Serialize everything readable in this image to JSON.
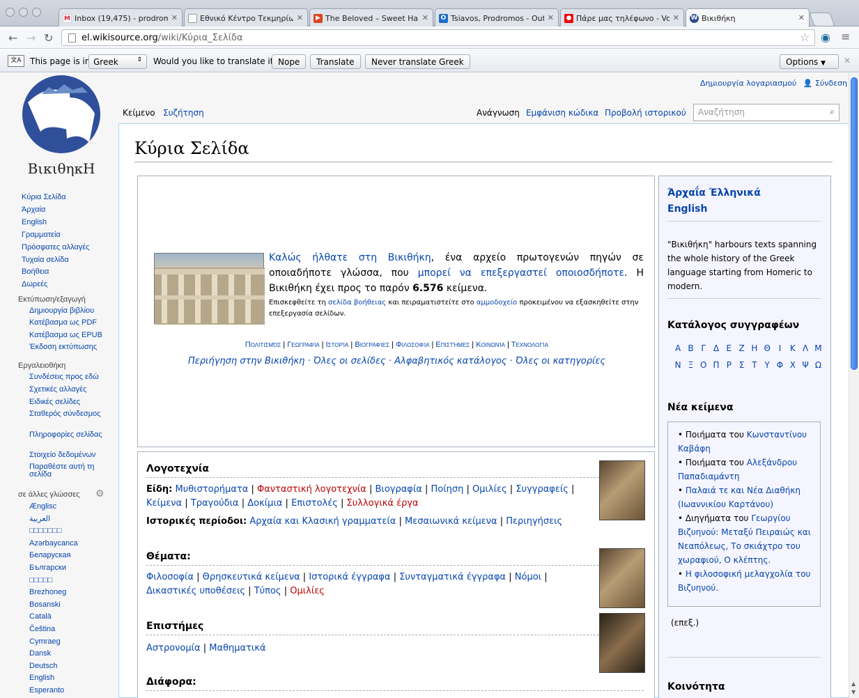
{
  "browser": {
    "tabs": [
      {
        "title": "Inbox (19,475) - prodromo",
        "icon": "gmail-icon"
      },
      {
        "title": "Εθνικό Κέντρο Τεκμηρίωση",
        "icon": "page-icon"
      },
      {
        "title": "The Beloved – Sweet Ha",
        "icon": "youtube-icon"
      },
      {
        "title": "Tsiavos, Prodromos - Outl",
        "icon": "outlook-icon"
      },
      {
        "title": "Πάρε μας τηλέφωνο - Vod",
        "icon": "vodafone-icon"
      },
      {
        "title": "Βικιθήκη",
        "icon": "wikisource-icon"
      }
    ],
    "url_host": "el.wikisource.org",
    "url_path": "/wiki/Κύρια_Σελίδα",
    "translate": {
      "prefix": "This page is in",
      "language": "Greek",
      "question": "Would you like to translate it?",
      "nope": "Nope",
      "translate": "Translate",
      "never": "Never translate Greek",
      "options": "Options"
    }
  },
  "logo": {
    "wordmark": "ΒικιθηκΗ"
  },
  "sidebar": {
    "nav": [
      "Κύρια Σελίδα",
      "Άρχαία",
      "English",
      "Γραμματεία",
      "Πρόσφατες αλλαγές",
      "Τυχαία σελίδα",
      "Βοήθεια",
      "Δωρεές"
    ],
    "print_head": "Εκτύπωση/εξαγωγή",
    "print": [
      "Δημιουργία βιβλίου",
      "Κατέβασμα ως PDF",
      "Κατέβασμα ως EPUB",
      "Έκδοση εκτύπωσης"
    ],
    "tools_head": "Εργαλειοθήκη",
    "tools": [
      "Συνδέσεις προς εδώ",
      "Σχετικές αλλαγές",
      "Ειδικές σελίδες",
      "Σταθερός σύνδεσμος",
      "Πληροφορίες σελίδας",
      "Στοιχείο δεδομένων",
      "Παραθέστε αυτή τη σελίδα"
    ],
    "lang_head": "σε άλλες γλώσσες",
    "langs": [
      "Ænglisc",
      "العربية",
      "□□□□□□□",
      "Azərbaycanca",
      "Беларуская",
      "Български",
      "□□□□□",
      "Brezhoneg",
      "Bosanski",
      "Català",
      "Čeština",
      "Cymraeg",
      "Dansk",
      "Deutsch",
      "English",
      "Esperanto"
    ]
  },
  "personal": {
    "create": "Δημιουργία λογαριασμού",
    "login": "Σύνδεση"
  },
  "tabs": {
    "page": "Κείμενο",
    "talk": "Συζήτηση",
    "read": "Ανάγνωση",
    "source": "Εμφάνιση κώδικα",
    "history": "Προβολή ιστορικού"
  },
  "search": {
    "placeholder": "Αναζήτηση"
  },
  "page_title": "Κύρια Σελίδα",
  "welcome": {
    "w1": "Καλώς ήλθατε στη Βικιθήκη",
    "w2": ", ένα αρχείο πρωτογενών πηγών σε οποιαδήποτε γλώσσα, που ",
    "w3": "μπορεί να επεξεργαστεί οποιοσδήποτε",
    "w4": ". Η Βικιθήκη έχει προς το παρόν ",
    "count": "6.576",
    "w5": " κείμενα.",
    "s1": "Επισκεφθείτε τη ",
    "s2": "σελίδα βοήθειας",
    "s3": " και πειραματιστείτε στο ",
    "s4": "αμμοδοχείο",
    "s5": " προκειμένου να εξασκηθείτε στην επεξεργασία σελίδων.",
    "cats": [
      "Πολιτισμός",
      "Γεωγραφία",
      "Ιστορία",
      "Βιογραφίες",
      "Φιλοσοφία",
      "Επιστήμες",
      "Κοινωνία",
      "Τεχνολογία"
    ],
    "nav": [
      "Περιήγηση στην Βικιθήκη",
      "Όλες οι σελίδες",
      "Αλφαβητικός κατάλογος",
      "Όλες οι κατηγορίες"
    ]
  },
  "literature": {
    "title": "Λογοτεχνία",
    "genres_label": "Είδη:",
    "genres": [
      "Μυθιστορήματα",
      "Φανταστική λογοτεχνία",
      "Βιογραφία",
      "Ποίηση",
      "Ομιλίες",
      "Συγγραφείς",
      "Κείμενα",
      "Τραγούδια",
      "Δοκίμια",
      "Επιστολές",
      "Συλλογικά έργα"
    ],
    "periods_label": "Ιστορικές περίοδοι:",
    "periods": [
      "Αρχαία και Κλασική γραμματεία",
      "Μεσαιωνικά κείμενα",
      "Περιηγήσεις"
    ],
    "themes_title": "Θέματα:",
    "themes": [
      "Φιλοσοφία",
      "Θρησκευτικά κείμενα",
      "Ιστορικά έγγραφα",
      "Συνταγματικά έγγραφα",
      "Νόμοι",
      "Δικαστικές υποθέσεις",
      "Τύπος",
      "Ομιλίες"
    ],
    "science_title": "Επιστήμες",
    "science": [
      "Αστρονομία",
      "Μαθηματικά"
    ],
    "misc_title": "Διάφορα:"
  },
  "right": {
    "ancient": "Άρχαΐα Έλληνικά",
    "english": "English",
    "blurb": "\"Βικιθήκη\" harbours texts spanning the whole history of the Greek language starting from Homeric to modern.",
    "authors_title": "Κατάλογος συγγραφέων",
    "letters1": [
      "Α",
      "Β",
      "Γ",
      "Δ",
      "Ε",
      "Ζ",
      "Η",
      "Θ",
      "Ι",
      "Κ",
      "Λ",
      "Μ"
    ],
    "letters2": [
      "Ν",
      "Ξ",
      "Ο",
      "Π",
      "Ρ",
      "Σ",
      "Τ",
      "Υ",
      "Φ",
      "Χ",
      "Ψ",
      "Ω"
    ],
    "new_title": "Νέα κείμενα",
    "n1a": "Ποιήματα του ",
    "n1b": "Κωνσταντίνου Καβάφη",
    "n2a": "Ποιήματα του ",
    "n2b": "Αλεξάνδρου Παπαδιαμάντη",
    "n3": "Παλαιά τε και Νέα Διαθήκη (Ιωαννικίου Καρτάνου)",
    "n4a": "Διηγήματα του ",
    "n4b": "Γεωργίου Βιζυηνού",
    "n4c": ": Μεταξύ Πειραιώς και Νεαπόλεως, Το σκιάχτρο του χωραφιού, Ο κλέπτης.",
    "n5": "Η φιλοσοφική μελαγχολία του Βιζυηνού.",
    "edit": "(επεξ.)",
    "community": "Κοινότητα"
  }
}
